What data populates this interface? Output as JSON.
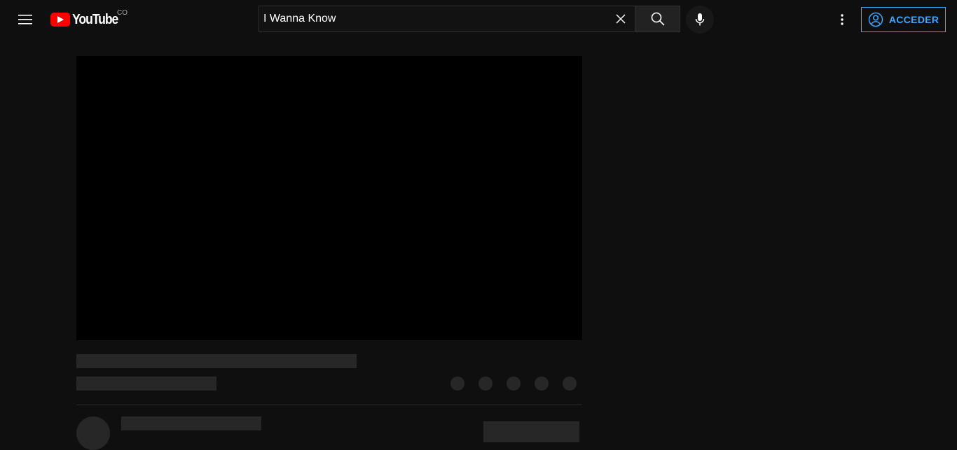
{
  "loading_progress": 0.21,
  "colors": {
    "background": "#0f0f0f",
    "brand_red": "#ff0000",
    "accent_blue": "#3ea6ff",
    "skeleton": "#272727"
  },
  "masthead": {
    "menu_icon": "hamburger-menu-icon",
    "logo": {
      "text": "YouTube",
      "country_code": "CO"
    },
    "search": {
      "value": "I Wanna Know",
      "clear_icon": "close-icon",
      "search_icon": "search-icon"
    },
    "voice_search_icon": "microphone-icon",
    "settings_icon": "vertical-dots-icon",
    "sign_in": {
      "label": "ACCEDER",
      "icon": "account-circle-icon"
    }
  },
  "watch_page": {
    "player_state": "loading",
    "placeholder_action_count": 5
  }
}
